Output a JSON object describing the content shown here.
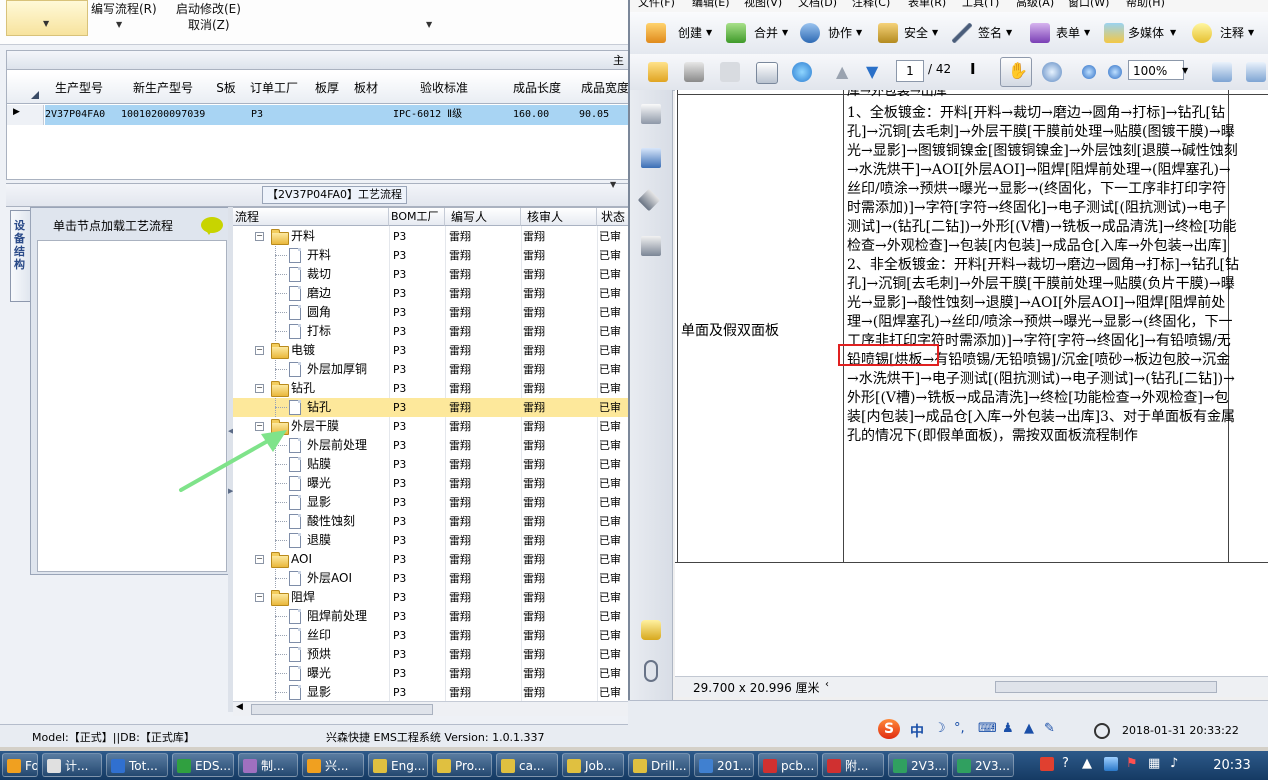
{
  "app_menu": {
    "item1": "编写流程(R)",
    "item2": "启动修改(E)",
    "item3": "取消(Z)"
  },
  "top_grid": {
    "headers": [
      "生产型号",
      "新生产型号",
      "S板",
      "订单工厂",
      "板厚",
      "板材",
      "验收标准",
      "成品长度",
      "成品宽度"
    ],
    "row": [
      "2V37P04FA0",
      "10010200097039",
      "",
      "P3",
      "",
      "",
      "IPC-6012 Ⅱ级",
      "160.00",
      "90.05"
    ]
  },
  "process_panel": {
    "title": "【2V37P04FA0】工艺流程",
    "vertical_tab": "设备结构",
    "node_hint": "单击节点加载工艺流程"
  },
  "tree": {
    "headers": [
      "流程",
      "BOM工厂",
      "编写人",
      "核审人",
      "状态"
    ],
    "rows": [
      {
        "level": 0,
        "name": "开料",
        "bom": "P3",
        "writer": "雷翔",
        "reviewer": "雷翔",
        "status": "已审"
      },
      {
        "level": 1,
        "name": "开料",
        "bom": "P3",
        "writer": "雷翔",
        "reviewer": "雷翔",
        "status": "已审"
      },
      {
        "level": 1,
        "name": "裁切",
        "bom": "P3",
        "writer": "雷翔",
        "reviewer": "雷翔",
        "status": "已审"
      },
      {
        "level": 1,
        "name": "磨边",
        "bom": "P3",
        "writer": "雷翔",
        "reviewer": "雷翔",
        "status": "已审"
      },
      {
        "level": 1,
        "name": "圆角",
        "bom": "P3",
        "writer": "雷翔",
        "reviewer": "雷翔",
        "status": "已审"
      },
      {
        "level": 1,
        "name": "打标",
        "bom": "P3",
        "writer": "雷翔",
        "reviewer": "雷翔",
        "status": "已审"
      },
      {
        "level": 0,
        "name": "电镀",
        "bom": "P3",
        "writer": "雷翔",
        "reviewer": "雷翔",
        "status": "已审"
      },
      {
        "level": 1,
        "name": "外层加厚铜",
        "bom": "P3",
        "writer": "雷翔",
        "reviewer": "雷翔",
        "status": "已审"
      },
      {
        "level": 0,
        "name": "钻孔",
        "bom": "P3",
        "writer": "雷翔",
        "reviewer": "雷翔",
        "status": "已审"
      },
      {
        "level": 1,
        "name": "钻孔",
        "bom": "P3",
        "writer": "雷翔",
        "reviewer": "雷翔",
        "status": "已审",
        "selected": true
      },
      {
        "level": 0,
        "name": "外层干膜",
        "bom": "P3",
        "writer": "雷翔",
        "reviewer": "雷翔",
        "status": "已审"
      },
      {
        "level": 1,
        "name": "外层前处理",
        "bom": "P3",
        "writer": "雷翔",
        "reviewer": "雷翔",
        "status": "已审"
      },
      {
        "level": 1,
        "name": "贴膜",
        "bom": "P3",
        "writer": "雷翔",
        "reviewer": "雷翔",
        "status": "已审"
      },
      {
        "level": 1,
        "name": "曝光",
        "bom": "P3",
        "writer": "雷翔",
        "reviewer": "雷翔",
        "status": "已审"
      },
      {
        "level": 1,
        "name": "显影",
        "bom": "P3",
        "writer": "雷翔",
        "reviewer": "雷翔",
        "status": "已审"
      },
      {
        "level": 1,
        "name": "酸性蚀刻",
        "bom": "P3",
        "writer": "雷翔",
        "reviewer": "雷翔",
        "status": "已审"
      },
      {
        "level": 1,
        "name": "退膜",
        "bom": "P3",
        "writer": "雷翔",
        "reviewer": "雷翔",
        "status": "已审"
      },
      {
        "level": 0,
        "name": "AOI",
        "bom": "P3",
        "writer": "雷翔",
        "reviewer": "雷翔",
        "status": "已审"
      },
      {
        "level": 1,
        "name": "外层AOI",
        "bom": "P3",
        "writer": "雷翔",
        "reviewer": "雷翔",
        "status": "已审"
      },
      {
        "level": 0,
        "name": "阻焊",
        "bom": "P3",
        "writer": "雷翔",
        "reviewer": "雷翔",
        "status": "已审"
      },
      {
        "level": 1,
        "name": "阻焊前处理",
        "bom": "P3",
        "writer": "雷翔",
        "reviewer": "雷翔",
        "status": "已审"
      },
      {
        "level": 1,
        "name": "丝印",
        "bom": "P3",
        "writer": "雷翔",
        "reviewer": "雷翔",
        "status": "已审"
      },
      {
        "level": 1,
        "name": "预烘",
        "bom": "P3",
        "writer": "雷翔",
        "reviewer": "雷翔",
        "status": "已审"
      },
      {
        "level": 1,
        "name": "曝光",
        "bom": "P3",
        "writer": "雷翔",
        "reviewer": "雷翔",
        "status": "已审"
      },
      {
        "level": 1,
        "name": "显影",
        "bom": "P3",
        "writer": "雷翔",
        "reviewer": "雷翔",
        "status": "已审"
      }
    ]
  },
  "left_status": {
    "model": "Model:【正式】||DB:【正式库】",
    "product": "兴森快捷 EMS工程系统 Version: 1.0.1.337"
  },
  "pdf": {
    "menu": [
      "文件(F)",
      "编辑(E)",
      "视图(V)",
      "文档(D)",
      "注释(C)",
      "表单(R)",
      "工具(T)",
      "高级(A)",
      "窗口(W)",
      "帮助(H)"
    ],
    "toolbar": [
      "创建",
      "合并",
      "协作",
      "安全",
      "签名",
      "表单",
      "多媒体",
      "注释"
    ],
    "page_current": "1",
    "page_total": "/ 42",
    "zoom": "100%",
    "page_size": "29.700 x 20.996 厘米",
    "cut_text": "库→外包装→出库",
    "left_cell": "单面及假双面板",
    "process_text": "1、全板镀金：开料[开料→裁切→磨边→圆角→打标]→钻孔[钻孔]→沉铜[去毛刺]→外层干膜[干膜前处理→贴膜(图镀干膜)→曝光→显影]→图镀铜镍金[图镀铜镍金]→外层蚀刻[退膜→碱性蚀刻→水洗烘干]→AOI[外层AOI]→阻焊[阻焊前处理→(阻焊塞孔)→丝印/喷涂→预烘→曝光→显影→(终固化，下一工序非打印字符时需添加)]→字符[字符→终固化]→电子测试[(阻抗测试)→电子测试]→(钻孔[二钻])→外形[(V槽)→铣板→成品清洗]→终检[功能检查→外观检查]→包装[内包装]→成品仓[入库→外包装→出库]2、非全板镀金：开料[开料→裁切→磨边→圆角→打标]→钻孔[钻孔]→沉铜[去毛刺]→外层干膜[干膜前处理→贴膜(负片干膜)→曝光→显影]→酸性蚀刻→退膜]→AOI[外层AOI]→阻焊[阻焊前处理→(阻焊塞孔)→丝印/喷涂→预烘→曝光→显影→(终固化，下一工序非打印字符时需添加)]→字符[字符→终固化]→有铅喷锡/无铅喷锡[烘板→有铅喷锡/无铅喷锡]/沉金[喷砂→板边包胶→沉金→水洗烘干]→电子测试[(阻抗测试)→电子测试]→(钻孔[二钻])→外形[(V槽)→铣板→成品清洗]→终检[功能检查→外观检查]→包装[内包装]→成品仓[入库→外包装→出库]3、对于单面板有金属孔的情况下(即假单面板)，需按双面板流程制作"
  },
  "tray": {
    "ime": "中",
    "datetime": "2018-01-31 20:33:22"
  },
  "taskbar": {
    "items": [
      "Fox...",
      "计...",
      "Tot...",
      "EDS...",
      "制...",
      "兴...",
      "Eng...",
      "Pro...",
      "ca...",
      "Job...",
      "Drill...",
      "201...",
      "pcb...",
      "附...",
      "2V3...",
      "2V3..."
    ],
    "clock": "20:33"
  },
  "colors": {
    "selection_row": "#fde89b",
    "grid_selection": "#a8d4f3",
    "red_highlight": "#e02020",
    "green_arrow": "#7fe38a",
    "taskbar": "#1f4a78"
  }
}
